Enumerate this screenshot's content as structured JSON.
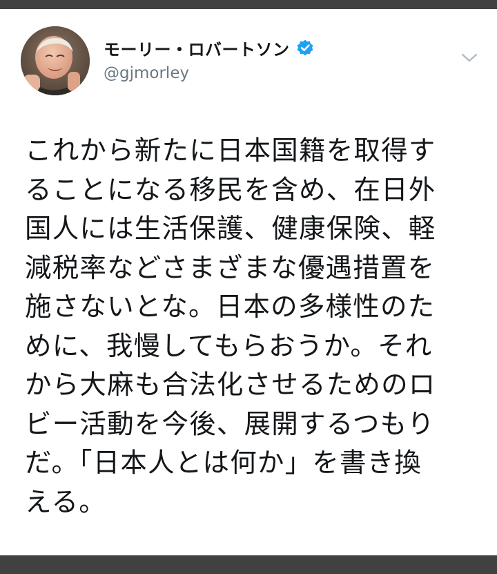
{
  "tweet": {
    "author": {
      "display_name": "モーリー・ロバートソン",
      "handle": "@gjmorley",
      "verified": true,
      "avatar_icon": "profile-photo"
    },
    "menu_icon": "chevron-down-icon",
    "text_lines": [
      "これから新たに日本国籍を取得す",
      "ることになる移民を含め、在日外",
      "国人には生活保護、健康保険、軽",
      "減税率などさまざまな優遇措置を",
      "施さないとな。日本の多様性のた",
      "めに、我慢してもらおうか。それ",
      "から大麻も合法化させるためのロ",
      "ビー活動を今後、展開するつもり",
      "だ。「日本人とは何か」を書き換",
      "える。"
    ]
  },
  "colors": {
    "frame": "#414141",
    "card": "#ffffff",
    "text": "#14171a",
    "handle": "#697882",
    "verified": "#1da1f2",
    "chevron": "#aab8c2"
  }
}
